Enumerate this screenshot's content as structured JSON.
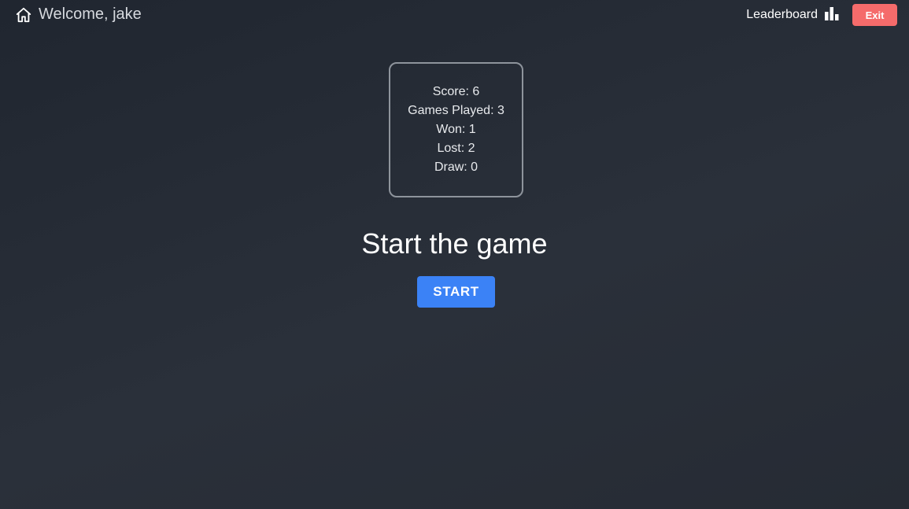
{
  "header": {
    "welcome_text": "Welcome, jake",
    "home_icon": "home-icon",
    "leaderboard_label": "Leaderboard",
    "leaderboard_icon": "bar-chart-icon",
    "exit_label": "Exit"
  },
  "stats": {
    "score": "Score: 6",
    "games_played": "Games Played: 3",
    "won": "Won: 1",
    "lost": "Lost: 2",
    "draw": "Draw: 0"
  },
  "main": {
    "title": "Start the game",
    "start_label": "START"
  },
  "colors": {
    "background": "#262b34",
    "exit_button": "#f56b6b",
    "start_button": "#3b82f6",
    "card_border": "#8e949c"
  }
}
